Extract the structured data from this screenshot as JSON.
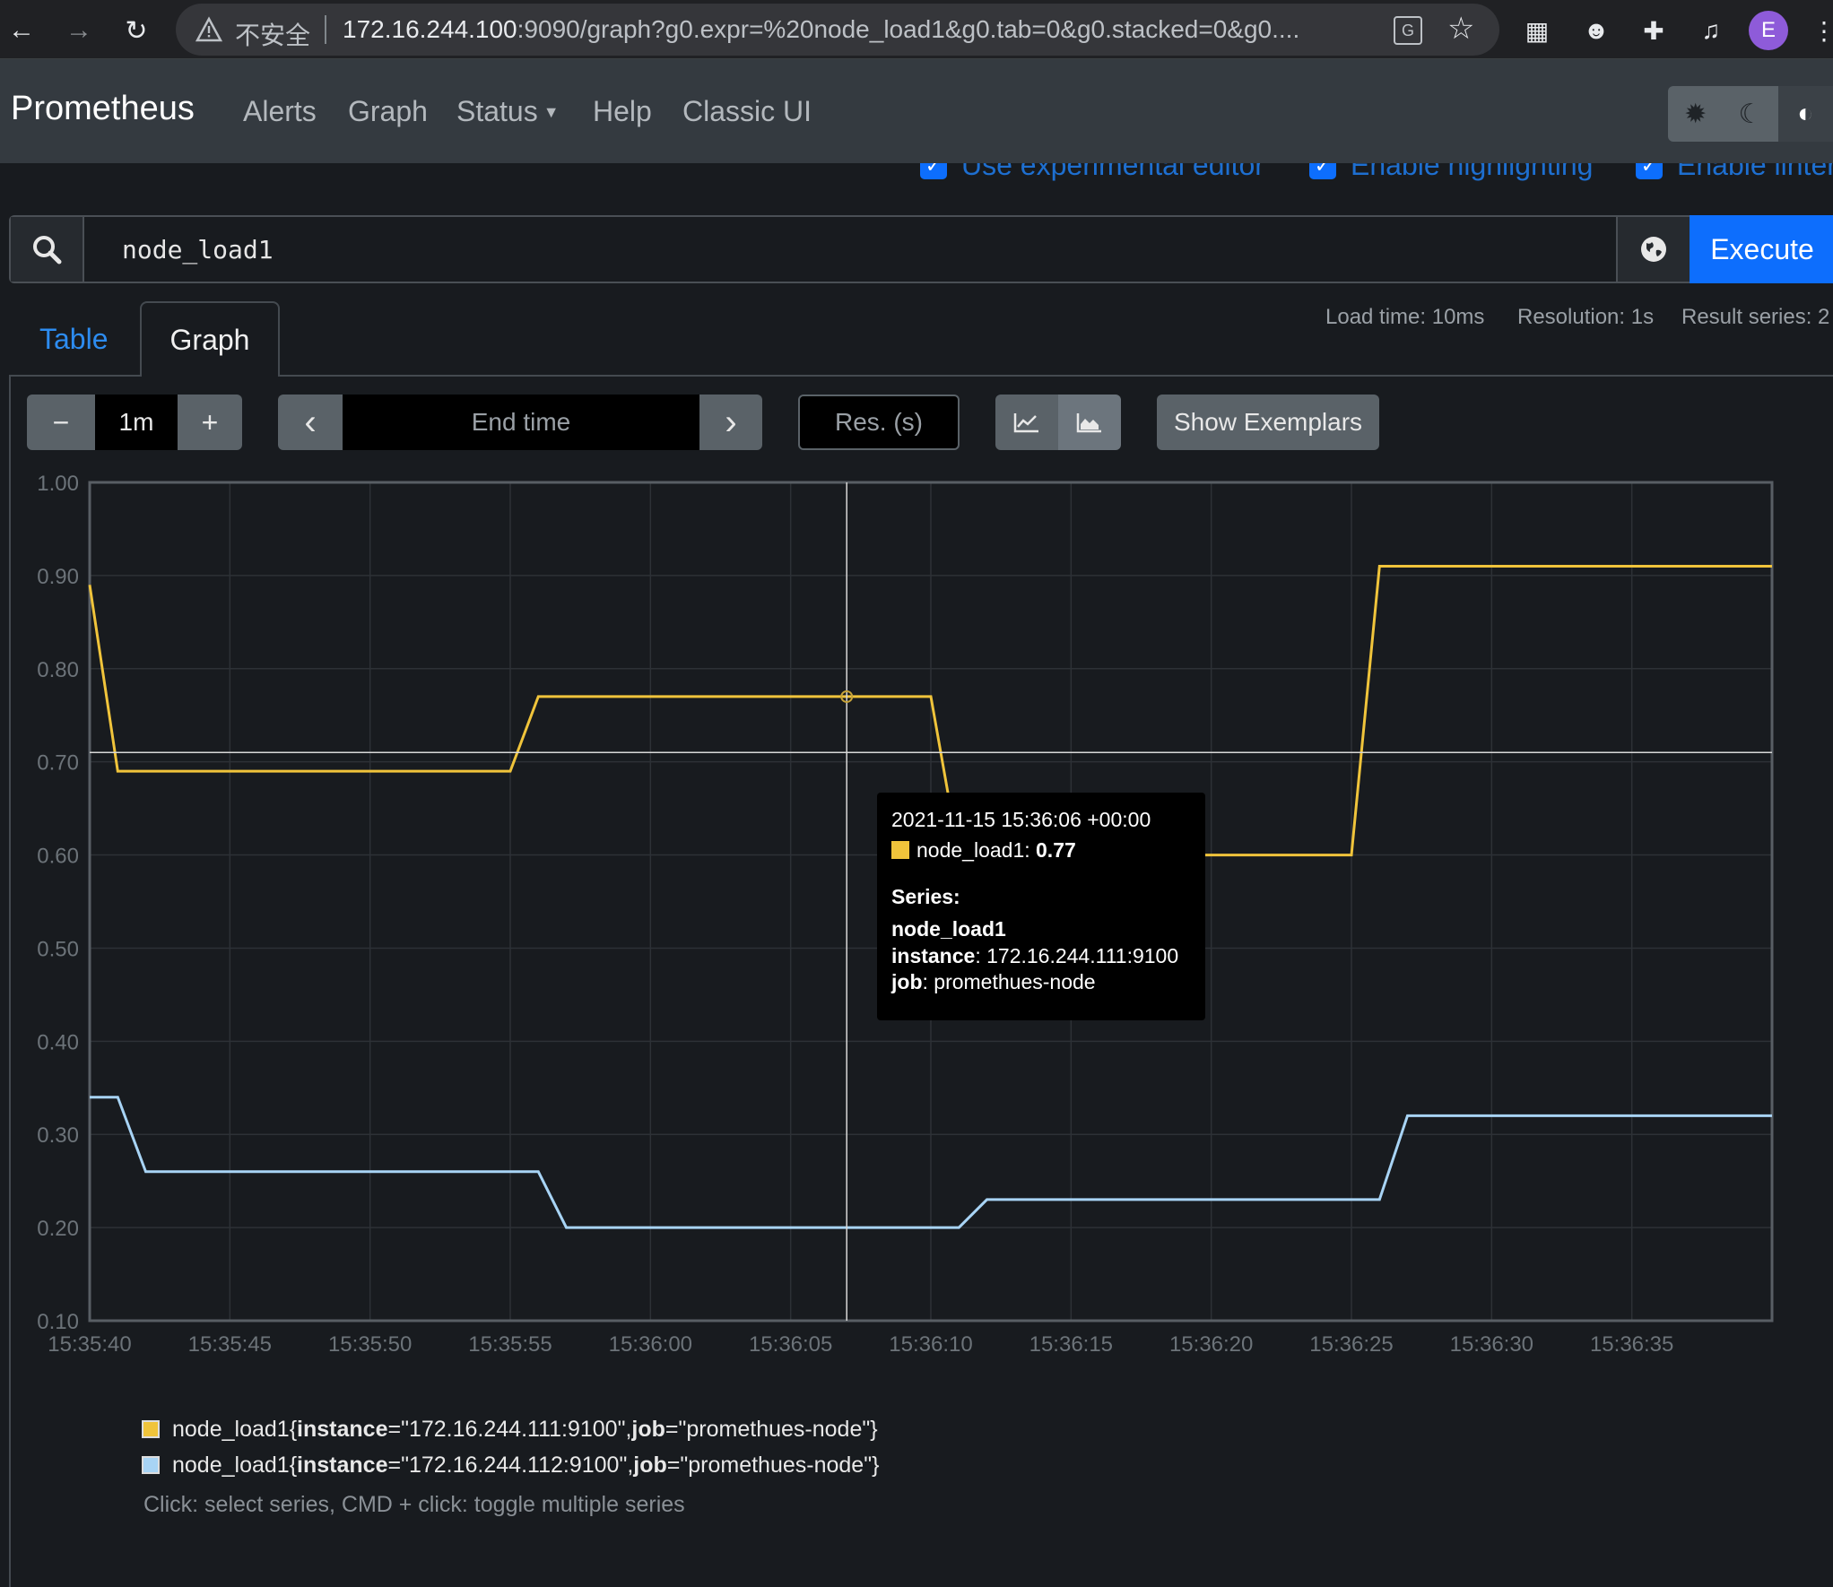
{
  "browser": {
    "insecure_label": "不安全",
    "url_host": "172.16.244.100",
    "url_rest": ":9090/graph?g0.expr=%20node_load1&g0.tab=0&g0.stacked=0&g0....",
    "avatar_letter": "E"
  },
  "navbar": {
    "brand": "Prometheus",
    "links": [
      "Alerts",
      "Graph",
      "Status",
      "Help",
      "Classic UI"
    ]
  },
  "options": {
    "experimental_editor": "Use experimental editor",
    "highlighting": "Enable highlighting",
    "linter": "Enable linter"
  },
  "query": {
    "expression": "node_load1",
    "execute_label": "Execute"
  },
  "tabs": {
    "table": "Table",
    "graph": "Graph"
  },
  "stats": {
    "load_time": "Load time: 10ms",
    "resolution": "Resolution: 1s",
    "result_series": "Result series: 2"
  },
  "controls": {
    "minus": "−",
    "range": "1m",
    "plus": "+",
    "prev": "‹",
    "end_time_placeholder": "End time",
    "next": "›",
    "res_placeholder": "Res. (s)",
    "show_exemplars": "Show Exemplars"
  },
  "chart_data": {
    "type": "line",
    "ylim": [
      0.1,
      1.0
    ],
    "y_ticks": [
      "1.00",
      "0.90",
      "0.80",
      "0.70",
      "0.60",
      "0.50",
      "0.40",
      "0.30",
      "0.20",
      "0.10"
    ],
    "x_ticks": [
      "15:35:40",
      "15:35:45",
      "15:35:50",
      "15:35:55",
      "15:36:00",
      "15:36:05",
      "15:36:10",
      "15:36:15",
      "15:36:20",
      "15:36:25",
      "15:36:30",
      "15:36:35"
    ],
    "x_start": "15:35:40",
    "x_end": "15:36:40",
    "series": [
      {
        "name": "node_load1{instance=\"172.16.244.111:9100\", job=\"promethues-node\"}",
        "color": "#f0c43b",
        "points": [
          [
            "15:35:40",
            0.89
          ],
          [
            "15:35:41",
            0.69
          ],
          [
            "15:35:55",
            0.69
          ],
          [
            "15:35:56",
            0.77
          ],
          [
            "15:36:10",
            0.77
          ],
          [
            "15:36:11",
            0.6
          ],
          [
            "15:36:25",
            0.6
          ],
          [
            "15:36:26",
            0.91
          ],
          [
            "15:36:40",
            0.91
          ]
        ]
      },
      {
        "name": "node_load1{instance=\"172.16.244.112:9100\", job=\"promethues-node\"}",
        "color": "#a8d4f5",
        "points": [
          [
            "15:35:40",
            0.34
          ],
          [
            "15:35:41",
            0.34
          ],
          [
            "15:35:42",
            0.26
          ],
          [
            "15:35:56",
            0.26
          ],
          [
            "15:35:57",
            0.2
          ],
          [
            "15:36:11",
            0.2
          ],
          [
            "15:36:12",
            0.23
          ],
          [
            "15:36:26",
            0.23
          ],
          [
            "15:36:27",
            0.32
          ],
          [
            "15:36:40",
            0.32
          ]
        ]
      }
    ],
    "crosshair": {
      "x": "15:36:07",
      "y": 0.71
    },
    "hover_point": {
      "x": "15:36:07",
      "y": 0.77
    }
  },
  "tooltip": {
    "timestamp": "2021-11-15 15:36:06 +00:00",
    "metric": "node_load1",
    "value": "0.77",
    "series_label": "Series:",
    "series_name": "node_load1",
    "instance_key": "instance",
    "instance_value": "172.16.244.111:9100",
    "job_key": "job",
    "job_value": "promethues-node"
  },
  "legend": {
    "items": [
      {
        "metric": "node_load1{",
        "instance_key": "instance",
        "instance_val": "=\"172.16.244.111:9100\", ",
        "job_key": "job",
        "job_val": "=\"promethues-node\"}",
        "color": "#f0c43b"
      },
      {
        "metric": "node_load1{",
        "instance_key": "instance",
        "instance_val": "=\"172.16.244.112:9100\", ",
        "job_key": "job",
        "job_val": "=\"promethues-node\"}",
        "color": "#a8d4f5"
      }
    ],
    "hint": "Click: select series, CMD + click: toggle multiple series"
  }
}
